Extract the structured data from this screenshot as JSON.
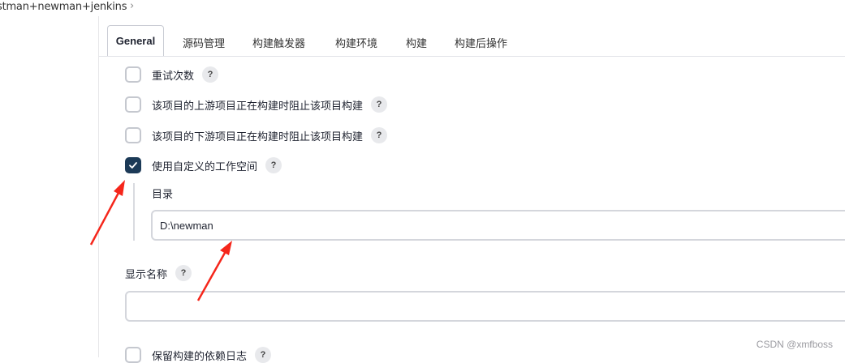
{
  "breadcrumb": {
    "text": "stman+newman+jenkins",
    "chevron": "›"
  },
  "tabs": [
    {
      "label": "General",
      "active": true
    },
    {
      "label": "源码管理"
    },
    {
      "label": "构建触发器"
    },
    {
      "label": "构建环境"
    },
    {
      "label": "构建"
    },
    {
      "label": "构建后操作"
    }
  ],
  "options": [
    {
      "label": "重试次数",
      "checked": false
    },
    {
      "label": "该项目的上游项目正在构建时阻止该项目构建",
      "checked": false
    },
    {
      "label": "该项目的下游项目正在构建时阻止该项目构建",
      "checked": false
    },
    {
      "label": "使用自定义的工作空间",
      "checked": true
    },
    {
      "label": "保留构建的依赖日志",
      "checked": false
    }
  ],
  "help_glyph": "?",
  "workspace": {
    "directory_label": "目录",
    "directory_value": "D:\\newman"
  },
  "display_name": {
    "label": "显示名称",
    "value": ""
  },
  "watermark": "CSDN @xmfboss",
  "colors": {
    "checked_bg": "#1c3a57",
    "arrow": "#f5261b"
  },
  "icons": {
    "check": "check-icon",
    "help": "help-icon"
  }
}
